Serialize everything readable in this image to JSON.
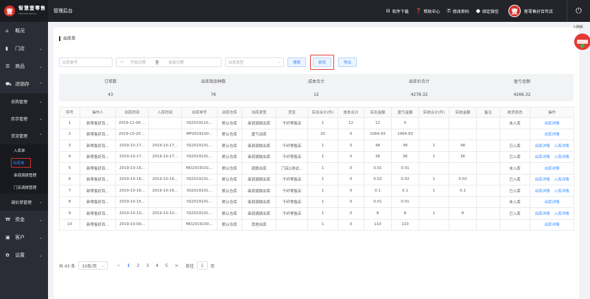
{
  "header": {
    "brand_logo_char": "壹",
    "brand_name": "智慧壹零售",
    "brand_sub": "WISDOM RETAIL",
    "title": "管理后台",
    "links": [
      {
        "icon": "download-icon",
        "label": "软件下载"
      },
      {
        "icon": "help-icon",
        "label": "帮助中心"
      },
      {
        "icon": "key-icon",
        "label": "修改密码"
      },
      {
        "icon": "wechat-icon",
        "label": "绑定微信"
      }
    ],
    "avatar_char": "壹",
    "store_name": "新零售好百年店"
  },
  "sidebar": {
    "items": [
      {
        "label": "概况",
        "icon": "home-icon",
        "chev": ""
      },
      {
        "label": "门店",
        "icon": "store-icon",
        "chev": "⌄"
      },
      {
        "label": "商品",
        "icon": "goods-icon",
        "chev": "⌄"
      },
      {
        "label": "进销存",
        "icon": "truck-icon",
        "chev": "⌃"
      }
    ],
    "sub": [
      {
        "label": "采购管理",
        "chev": "⌄"
      },
      {
        "label": "库存管理",
        "chev": "⌄"
      },
      {
        "label": "货流管理",
        "chev": "⌃"
      }
    ],
    "leaves": [
      "入库单",
      "出库单",
      "串调调拨管理",
      "门店调拨管理"
    ],
    "sub2": {
      "label": "调价单管理",
      "chev": "⌄"
    },
    "bottom": [
      {
        "label": "资金",
        "icon": "money-icon",
        "chev": "⌄"
      },
      {
        "label": "客户",
        "icon": "customer-icon",
        "chev": "⌄"
      },
      {
        "label": "设置",
        "icon": "gear-icon",
        "chev": "⌄"
      }
    ]
  },
  "page": {
    "title": "出库单",
    "refresh_label": "刷新"
  },
  "filters": {
    "order_no_placeholder": "出库单号",
    "start_date": "开始日期",
    "date_sep": "至",
    "end_date": "结束日期",
    "type_placeholder": "出库类型",
    "search_label": "搜索",
    "new_label": "新增",
    "export_label": "导出"
  },
  "summary": {
    "headers": [
      "订单数",
      "出库商品种数",
      "成本合计",
      "出库价合计",
      "盈亏金额"
    ],
    "values": [
      "43",
      "76",
      "12",
      "4278.32",
      "4266.32"
    ]
  },
  "table": {
    "columns": [
      "序号",
      "操作人",
      "出库时间",
      "入库时间",
      "出库单号",
      "出库仓库",
      "出库类型",
      "货至",
      "实出合计(件)",
      "成本合计",
      "实出金额",
      "盈亏金额",
      "实收合计(件)",
      "实收金额",
      "备注",
      "收货状态",
      "操作"
    ],
    "rows": [
      [
        "1",
        "新零售好百...",
        "2019-11-06 ...",
        "",
        "SS2019110...",
        "默认仓库",
        "串调调拨出库",
        "千纤零售店",
        "1",
        "12",
        "12",
        "0",
        "",
        "",
        "",
        "未入库",
        "出库详情",
        ""
      ],
      [
        "2",
        "新零售好百...",
        "2019-10-20 ...",
        "",
        "MP2019100...",
        "默认仓库",
        "盘亏出库",
        "",
        "20",
        "0",
        "1064.93",
        "1064.93",
        "",
        "",
        "",
        "",
        "出库详情",
        ""
      ],
      [
        "3",
        "新零售好百...",
        "2019-10-17...",
        "2019-10-17...",
        "SS2019101...",
        "默认仓库",
        "串调调拨出库",
        "千纤零售店",
        "1",
        "0",
        "48",
        "48",
        "1",
        "48",
        "",
        "已入库",
        "出库详情",
        "入库详情"
      ],
      [
        "4",
        "新零售好百...",
        "2019-10-17...",
        "2019-10-17...",
        "SS2019101...",
        "默认仓库",
        "串调调拨出库",
        "千纤零售店",
        "1",
        "0",
        "36",
        "36",
        "1",
        "36",
        "",
        "已入库",
        "出库详情",
        "入库详情"
      ],
      [
        "5",
        "新零售好百...",
        "2019-10-16...",
        "",
        "MD2019101...",
        "默认仓库",
        "调拨出库",
        "门店1测试...",
        "1",
        "0",
        "0.01",
        "0.01",
        "",
        "",
        "",
        "未入库",
        "出库详情",
        ""
      ],
      [
        "6",
        "新零售好百...",
        "2019-10-16...",
        "2019-10-16...",
        "SS2019101...",
        "默认仓库",
        "串调调拨出库",
        "千纤零售店",
        "1",
        "0",
        "0.02",
        "0.02",
        "1",
        "0.02",
        "",
        "已入库",
        "出库详情",
        "入库详情"
      ],
      [
        "7",
        "新零售好百...",
        "2019-10-16...",
        "2019-10-16...",
        "SS2019101...",
        "默认仓库",
        "串调调拨出库",
        "千纤零售店",
        "1",
        "0",
        "0.1",
        "0.1",
        "1",
        "0.1",
        "",
        "已入库",
        "出库详情",
        "入库详情"
      ],
      [
        "8",
        "新零售好百...",
        "2019-10-15...",
        "",
        "SS2019101...",
        "默认仓库",
        "串调调拨出库",
        "千纤零售店",
        "1",
        "0",
        "0.01",
        "0.01",
        "",
        "",
        "",
        "未入库",
        "出库详情",
        ""
      ],
      [
        "9",
        "新零售好百...",
        "2019-10-10...",
        "2019-10-10...",
        "SS2019101...",
        "默认仓库",
        "串调调拨出库",
        "千纤零售店",
        "1",
        "0",
        "8",
        "8",
        "1",
        "8",
        "",
        "已入库",
        "出库详情",
        "入库详情"
      ],
      [
        "10",
        "新零售好百...",
        "2019-10-09...",
        "",
        "MD2019100...",
        "默认仓库",
        "其他出库",
        "",
        "1",
        "0",
        "110",
        "110",
        "",
        "",
        "",
        "",
        "出库详情",
        ""
      ]
    ]
  },
  "pager": {
    "total": "共 43 条",
    "size": "10条/页",
    "prev": "<",
    "pages": [
      "1",
      "2",
      "3",
      "4",
      "5"
    ],
    "next": ">",
    "goto_label": "前往",
    "goto_value": "1",
    "page_suffix": "页"
  },
  "colors": {
    "accent": "#3b8cff",
    "highlight": "#e53935",
    "sidebar_bg": "#2a2d35",
    "topbar_bg": "#22242a"
  }
}
